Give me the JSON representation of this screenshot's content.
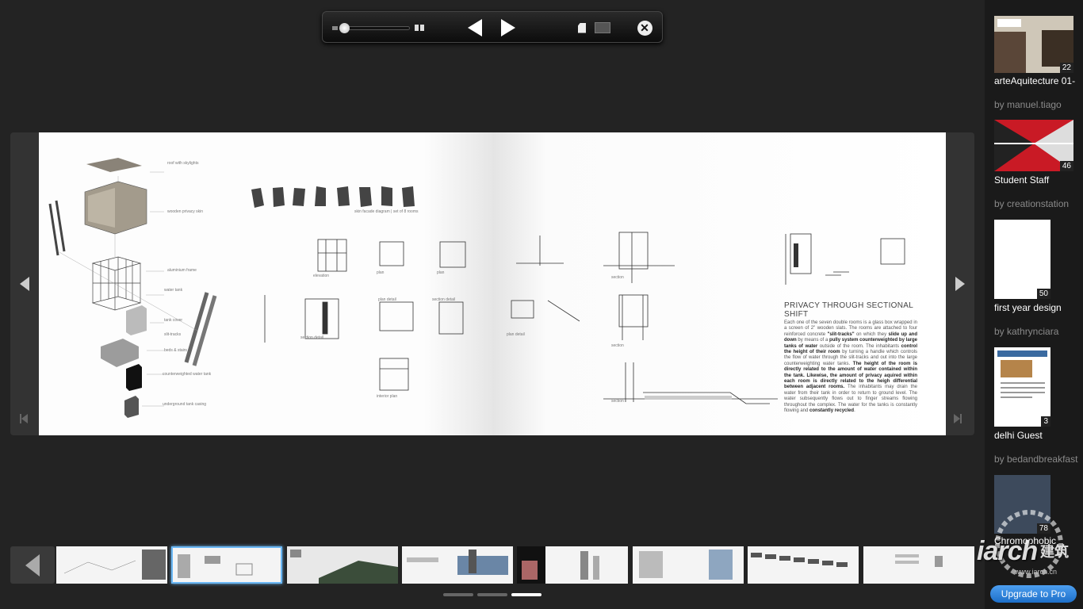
{
  "toolbar": {
    "icons": {
      "zoom_out": "zoom-small-icon",
      "zoom_in": "zoom-large-icon",
      "prev": "triangle-left-icon",
      "next": "triangle-right-icon",
      "single": "single-page-icon",
      "spread": "two-page-spread-icon",
      "close": "close-circle-icon"
    },
    "close_glyph": "✕"
  },
  "spread": {
    "left_labels": [
      "roof with skylights",
      "wooden privacy skin",
      "aluminium frame",
      "water tank",
      "tank cover",
      "slit-tracks",
      "beds & stairs",
      "counterweighted water tank",
      "underground tank casing",
      "skin facade diagram | set of 8 rooms",
      "elevation",
      "plan",
      "plan",
      "section detail",
      "plan detail",
      "section detail",
      "interior plan"
    ],
    "right_labels": [
      "section",
      "plan detail",
      "section",
      "section"
    ],
    "article_title": "PRIVACY THROUGH SECTIONAL SHIFT",
    "article_parts": [
      {
        "text": "Each one of the seven double rooms is a glass box wrapped in a screen of 2\" wooden slats. The rooms are attached to four reinforced concrete ",
        "bold": false
      },
      {
        "text": "\"slit-tracks\"",
        "bold": true
      },
      {
        "text": " on which they ",
        "bold": false
      },
      {
        "text": "slide up and down",
        "bold": true
      },
      {
        "text": " by means of a ",
        "bold": false
      },
      {
        "text": "pully system counterweighted by large tanks of water",
        "bold": true
      },
      {
        "text": " outside of the room. The inhabitants ",
        "bold": false
      },
      {
        "text": "control the height of their room",
        "bold": true
      },
      {
        "text": " by turning a handle which controls the flow of water through the slit-tracks and out into the large counterweighting water tanks. ",
        "bold": false
      },
      {
        "text": "The height of the room is directly related to the amount of water contained within the tank. Likewise, the amount of privacy aquired within each room is directly related to the heigh differential between adjacent rooms.",
        "bold": true
      },
      {
        "text": " The inhabitants may drain the water from their tank in order to return to ground level. The water subsequently flows out to finger streams flowing throughout the complex. The water for the tanks is constantly flowing and ",
        "bold": false
      },
      {
        "text": "constantly recycled",
        "bold": true
      },
      {
        "text": ".",
        "bold": false
      }
    ]
  },
  "strip": {
    "thumbnails": [
      {
        "selected": false
      },
      {
        "selected": true
      },
      {
        "selected": false
      },
      {
        "selected": false
      },
      {
        "selected": false
      },
      {
        "selected": false
      },
      {
        "selected": false
      },
      {
        "selected": false
      }
    ],
    "pager": [
      false,
      false,
      true
    ]
  },
  "related": [
    {
      "title": "arteAquitecture 01-",
      "author": "by manuel.tiago",
      "count": "22"
    },
    {
      "title": "Student Staff",
      "author": "by creationstation",
      "count": "46"
    },
    {
      "title": "first year design",
      "author": "by kathrynciara",
      "count": "50"
    },
    {
      "title": "delhi Guest",
      "author": "by bedandbreakfast",
      "count": "3"
    },
    {
      "title": "Chromophobic",
      "author": "",
      "count": "78"
    }
  ],
  "upgrade_label": "Upgrade to Pro",
  "watermark": {
    "logo": "iarch",
    "cn": "建筑",
    "url": "www.iarch.cn"
  },
  "colors": {
    "background": "#232323",
    "selected_thumb": "#6ab7f4",
    "upgrade": "#2f86e0"
  }
}
